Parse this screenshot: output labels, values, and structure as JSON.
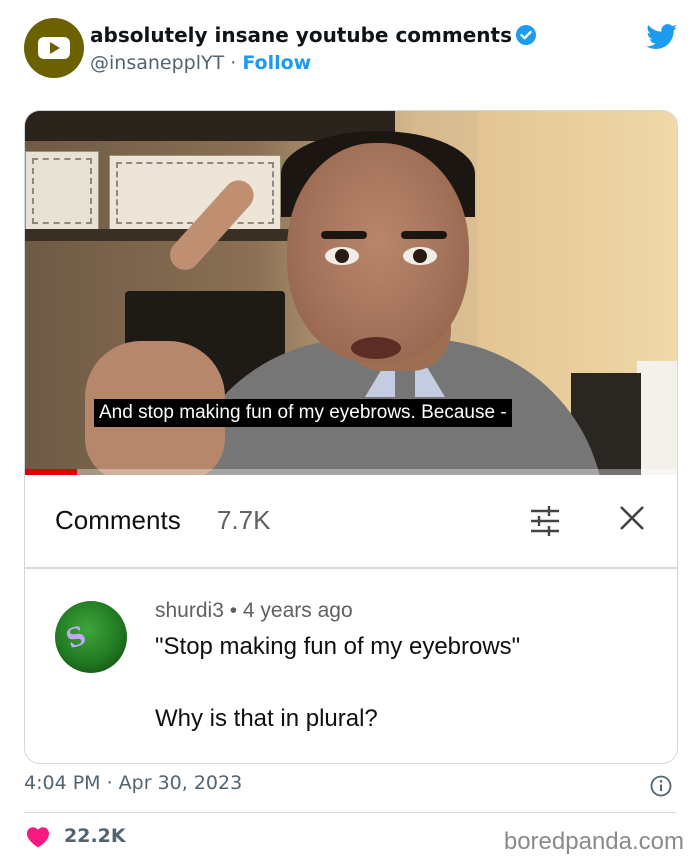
{
  "tweet": {
    "display_name": "absolutely insane youtube comments",
    "handle": "@insanepplYT",
    "separator": " · ",
    "follow_label": "Follow",
    "timestamp": "4:04 PM · Apr 30, 2023",
    "likes": "22.2K",
    "colors": {
      "accent": "#1d9bf0",
      "heart": "#f91880",
      "avatar": "#6b6100"
    }
  },
  "video": {
    "caption": "And stop making fun of my eyebrows. Because -",
    "progress_percent": 8
  },
  "comments_panel": {
    "title": "Comments",
    "count": "7.7K",
    "icons": [
      "filter-sliders-icon",
      "close-icon"
    ]
  },
  "comment": {
    "author": "shurdi3",
    "age": "4 years ago",
    "meta_separator": " • ",
    "line1": "\"Stop making fun of my eyebrows\"",
    "line2": "Why is that in plural?"
  },
  "watermark": "boredpanda.com"
}
